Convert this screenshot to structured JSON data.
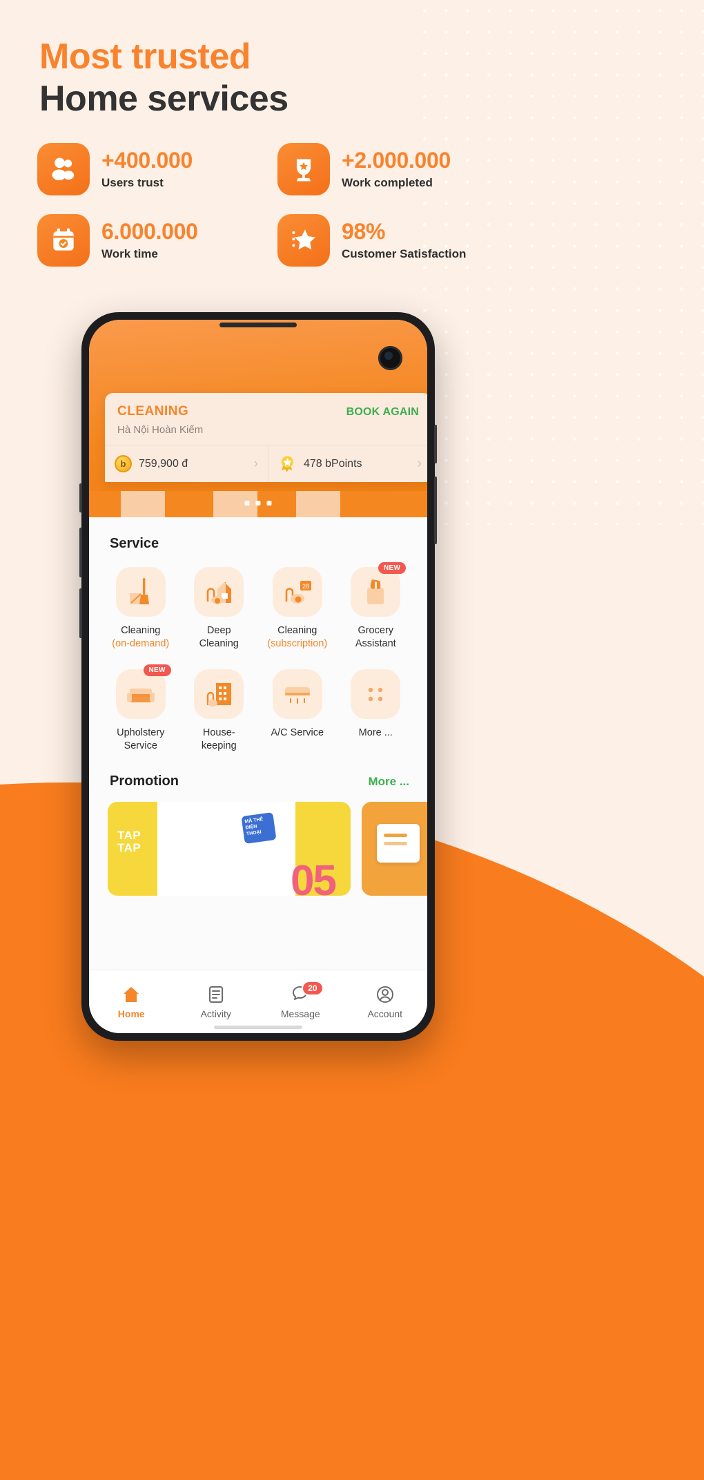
{
  "hero": {
    "line1": "Most trusted",
    "line2": "Home services",
    "accent_color": "#f9832d",
    "dark_color": "#333333",
    "bg_color": "#fdf0e6",
    "band_color": "#f97c1e"
  },
  "stats": [
    {
      "icon": "users-icon",
      "value": "+400.000",
      "label": "Users trust"
    },
    {
      "icon": "trophy-icon",
      "value": "+2.000.000",
      "label": "Work completed"
    },
    {
      "icon": "calendar-check-icon",
      "value": "6.000.000",
      "label": "Work time"
    },
    {
      "icon": "star-badge-icon",
      "value": "98%",
      "label": "Customer Satisfaction"
    }
  ],
  "phone": {
    "booking_card": {
      "title": "CLEANING",
      "subtitle": "Hà Nội Hoàn Kiếm",
      "action": "BOOK AGAIN",
      "action_color": "#3caf4f",
      "wallet": {
        "icon": "b-coin-icon",
        "value": "759,900 đ",
        "chevron": "›"
      },
      "points": {
        "icon": "medal-icon",
        "value": "478 bPoints",
        "chevron": "›"
      }
    },
    "service": {
      "heading": "Service",
      "items": [
        {
          "icon": "broom-bucket-icon",
          "line1": "Cleaning",
          "line2": "(on-demand)",
          "line2_accent": true,
          "badge": ""
        },
        {
          "icon": "vacuum-house-icon",
          "line1": "Deep",
          "line2": "Cleaning",
          "line2_accent": false,
          "badge": ""
        },
        {
          "icon": "vacuum-calendar-icon",
          "line1": "Cleaning",
          "line2": "(subscription)",
          "line2_accent": true,
          "badge": ""
        },
        {
          "icon": "grocery-bag-icon",
          "line1": "Grocery",
          "line2": "Assistant",
          "line2_accent": false,
          "badge": "NEW"
        },
        {
          "icon": "sofa-icon",
          "line1": "Upholstery",
          "line2": "Service",
          "line2_accent": false,
          "badge": "NEW"
        },
        {
          "icon": "building-icon",
          "line1": "House-",
          "line2": "keeping",
          "line2_accent": false,
          "badge": ""
        },
        {
          "icon": "air-conditioner-icon",
          "line1": "A/C Service",
          "line2": "",
          "line2_accent": false,
          "badge": ""
        },
        {
          "icon": "more-dots-icon",
          "line1": "More ...",
          "line2": "",
          "line2_accent": false,
          "badge": ""
        }
      ]
    },
    "promotion": {
      "heading": "Promotion",
      "more": "More ...",
      "banner_1": {
        "brand": "TAP\nTAP",
        "number": "05",
        "tag": "MÃ THẺ ĐIỆN THOẠI"
      },
      "banner_2": {
        "icon": "voucher-icon"
      }
    },
    "nav": [
      {
        "icon": "home-icon",
        "label": "Home",
        "active": true,
        "badge": ""
      },
      {
        "icon": "activity-icon",
        "label": "Activity",
        "active": false,
        "badge": ""
      },
      {
        "icon": "message-icon",
        "label": "Message",
        "active": false,
        "badge": "20"
      },
      {
        "icon": "account-icon",
        "label": "Account",
        "active": false,
        "badge": ""
      }
    ]
  }
}
